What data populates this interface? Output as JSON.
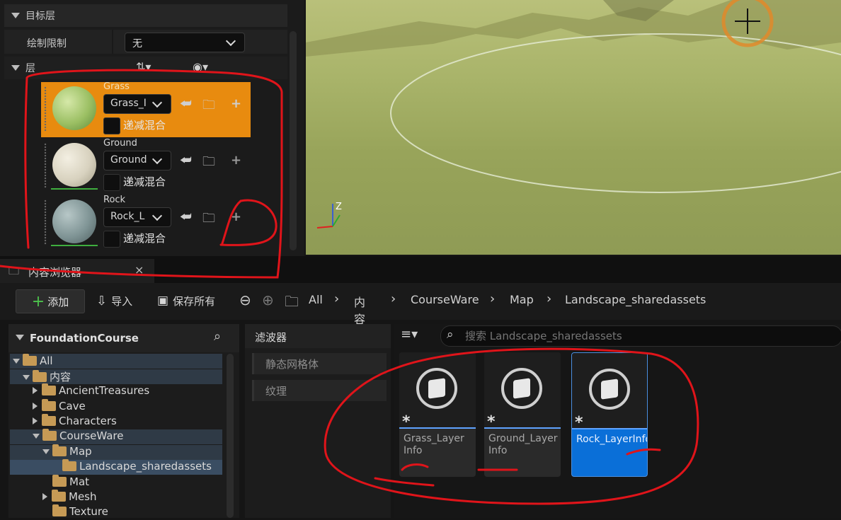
{
  "target_layer_section": {
    "title": "目标层",
    "paint_limit_label": "绘制限制",
    "paint_limit_value": "无"
  },
  "layers_section": {
    "title": "层",
    "items": [
      {
        "name": "Grass",
        "dropdown": "Grass_I",
        "blend": "递减混合",
        "selected": true,
        "color": "#9bbf63"
      },
      {
        "name": "Ground",
        "dropdown": "Ground",
        "blend": "递减混合",
        "selected": false,
        "color": "#d8d2bf"
      },
      {
        "name": "Rock",
        "dropdown": "Rock_L",
        "blend": "递减混合",
        "selected": false,
        "color": "#7f9495"
      }
    ]
  },
  "content_browser": {
    "tab_title": "内容浏览器",
    "toolbar": {
      "add_label": "添加",
      "import_label": "导入",
      "save_all_label": "保存所有"
    },
    "breadcrumb": [
      "All",
      "内容",
      "CourseWare",
      "Map",
      "Landscape_sharedassets"
    ],
    "tree": {
      "root": "FoundationCourse",
      "items": [
        {
          "label": "All",
          "level": 0,
          "expanded": true
        },
        {
          "label": "内容",
          "level": 1,
          "expanded": true
        },
        {
          "label": "AncientTreasures",
          "level": 2,
          "expanded": false
        },
        {
          "label": "Cave",
          "level": 2,
          "expanded": false
        },
        {
          "label": "Characters",
          "level": 2,
          "expanded": false
        },
        {
          "label": "CourseWare",
          "level": 2,
          "expanded": true
        },
        {
          "label": "Map",
          "level": 3,
          "expanded": true
        },
        {
          "label": "Landscape_sharedassets",
          "level": 4,
          "expanded": false
        },
        {
          "label": "Mat",
          "level": 3,
          "expanded": false
        },
        {
          "label": "Mesh",
          "level": 3,
          "expanded": false
        },
        {
          "label": "Texture",
          "level": 3,
          "expanded": false
        }
      ]
    },
    "filters": {
      "title": "滤波器",
      "items": [
        "静态网格体",
        "纹理"
      ]
    },
    "search_placeholder": "搜索 Landscape_sharedassets",
    "assets": [
      {
        "name_line1": "Grass_Layer",
        "name_line2": "Info",
        "selected": false
      },
      {
        "name_line1": "Ground_Layer",
        "name_line2": "Info",
        "selected": false
      },
      {
        "name_line1": "Rock_LayerInfo",
        "name_line2": "",
        "selected": true
      }
    ]
  },
  "colors": {
    "selected_layer": "#e88b0f",
    "selected_asset": "#0a6fd8",
    "annotation": "#e0141a"
  }
}
